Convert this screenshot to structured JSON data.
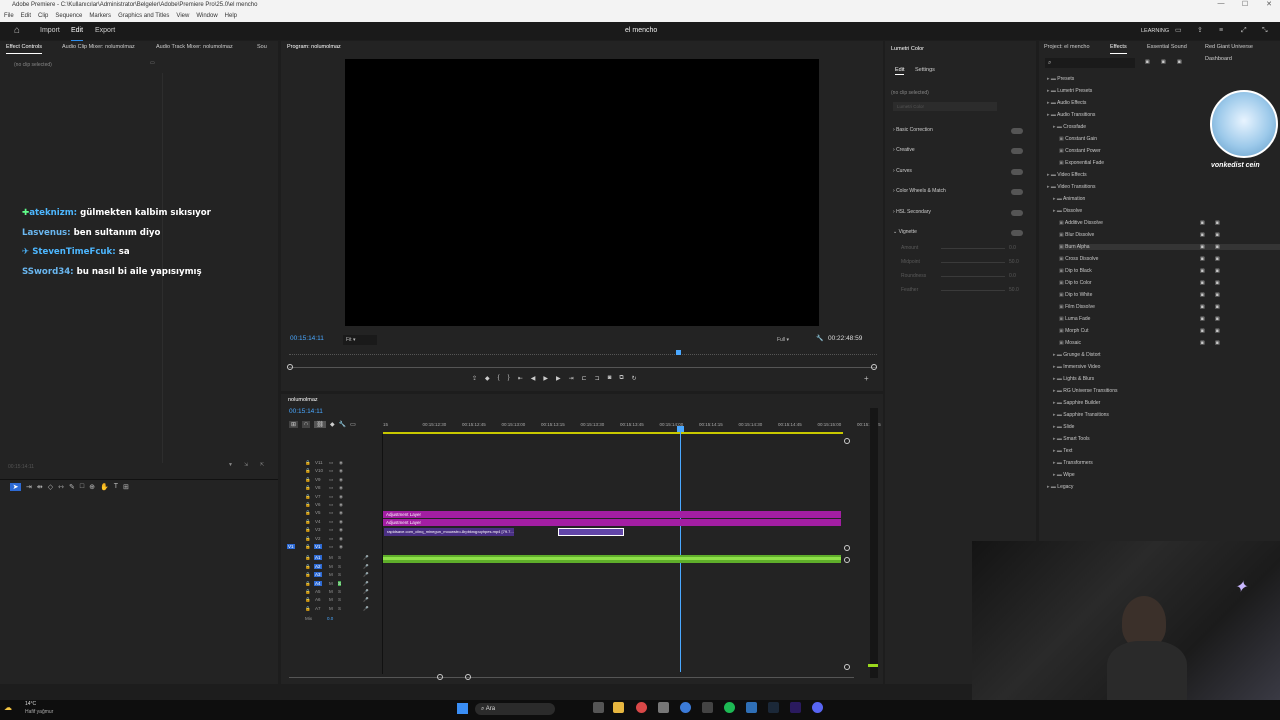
{
  "titlebar": {
    "title": "Adobe Premiere - C:\\Kullanıcılar\\Administrator\\Belgeler\\Adobe\\Premiere Pro\\25.0\\el mencho"
  },
  "menu": [
    "File",
    "Edit",
    "Clip",
    "Sequence",
    "Markers",
    "Graphics and Titles",
    "View",
    "Window",
    "Help"
  ],
  "header": {
    "tabs": [
      "Import",
      "Edit",
      "Export"
    ],
    "project_title": "el mencho",
    "learning": "LEARNING"
  },
  "left_panel": {
    "tabs": [
      "Effect Controls",
      "Audio Clip Mixer: nolumolmaz",
      "Audio Track Mixer: nolumolmaz",
      "Sou"
    ],
    "no_clip": "(no clip selected)",
    "timecode": "00:15:14:11"
  },
  "chat": [
    {
      "user": "ateknizm:",
      "text": "gülmekten kalbim sıkısıyor"
    },
    {
      "user": "Lasvenus:",
      "text": "ben sultanım diyo"
    },
    {
      "user": "StevenTimeFcuk:",
      "text": "sa"
    },
    {
      "user": "SSword34:",
      "text": "bu nasıl bi aile yapısıymış"
    }
  ],
  "program": {
    "tab": "Program: nolumolmaz",
    "timecode": "00:15:14:11",
    "fit": "Fit",
    "full": "Full",
    "duration": "00:22:48:59"
  },
  "timeline": {
    "tab": "nolumolmaz",
    "timecode": "00:15:14:11",
    "ruler": [
      "15",
      "00:15:12:30",
      "00:15:12:45",
      "00:15:13:00",
      "00:15:13:15",
      "00:15:13:30",
      "00:15:13:45",
      "00:15:14:00",
      "00:15:14:15",
      "00:15:14:30",
      "00:15:14:45",
      "00:15:15:00",
      "00:15:15:15"
    ],
    "video_tracks": [
      "V11",
      "V10",
      "V9",
      "V8",
      "V7",
      "V6",
      "V5",
      "V4",
      "V3",
      "V2",
      "V1"
    ],
    "audio_tracks": [
      "A1",
      "A2",
      "A3",
      "A4",
      "A5",
      "A6",
      "A7"
    ],
    "mix": "Mix",
    "mix_value": "0.0",
    "adj1": "Adjustment Layer",
    "adj2": "Adjustment Layer",
    "clip": "rapidsave.com_ciinq_minegun_mouwstro-8rpbknqpuyhpes.mp4 [79.7..."
  },
  "lumetri": {
    "tab": "Lumetri Color",
    "edit": "Edit",
    "settings": "Settings",
    "no_clip": "(no clip selected)",
    "dropdown": "Lumetri Color",
    "sections": [
      "Basic Correction",
      "Creative",
      "Curves",
      "Color Wheels & Match",
      "HSL Secondary",
      "Vignette"
    ],
    "vignette": [
      "Amount",
      "Midpoint",
      "Roundness",
      "Feather"
    ],
    "vignette_values": [
      "0.0",
      "50.0",
      "0.0",
      "50.0"
    ]
  },
  "effects": {
    "tabs": [
      "Project: el mencho",
      "Effects",
      "Essential Sound",
      "Red Giant Universe Dashboard"
    ],
    "tree": [
      {
        "label": "Presets",
        "level": 0
      },
      {
        "label": "Lumetri Presets",
        "level": 0
      },
      {
        "label": "Audio Effects",
        "level": 0
      },
      {
        "label": "Audio Transitions",
        "level": 0
      },
      {
        "label": "Crossfade",
        "level": 1
      },
      {
        "label": "Constant Gain",
        "level": 2
      },
      {
        "label": "Constant Power",
        "level": 2
      },
      {
        "label": "Exponential Fade",
        "level": 2
      },
      {
        "label": "Video Effects",
        "level": 0
      },
      {
        "label": "Video Transitions",
        "level": 0
      },
      {
        "label": "Animation",
        "level": 1
      },
      {
        "label": "Dissolve",
        "level": 1
      },
      {
        "label": "Additive Dissolve",
        "level": 2
      },
      {
        "label": "Blur Dissolve",
        "level": 2
      },
      {
        "label": "Burn Alpha",
        "level": 2
      },
      {
        "label": "Cross Dissolve",
        "level": 2
      },
      {
        "label": "Dip to Black",
        "level": 2
      },
      {
        "label": "Dip to Color",
        "level": 2
      },
      {
        "label": "Dip to White",
        "level": 2
      },
      {
        "label": "Film Dissolve",
        "level": 2
      },
      {
        "label": "Luma Fade",
        "level": 2
      },
      {
        "label": "Morph Cut",
        "level": 2
      },
      {
        "label": "Mosaic",
        "level": 2
      },
      {
        "label": "Grunge & Distort",
        "level": 1
      },
      {
        "label": "Immersive Video",
        "level": 1
      },
      {
        "label": "Lights & Blurs",
        "level": 1
      },
      {
        "label": "RG Universe Transitions",
        "level": 1
      },
      {
        "label": "Sapphire Builder",
        "level": 1
      },
      {
        "label": "Sapphire Transitions",
        "level": 1
      },
      {
        "label": "Slide",
        "level": 1
      },
      {
        "label": "Smart Tools",
        "level": 1
      },
      {
        "label": "Text",
        "level": 1
      },
      {
        "label": "Transformers",
        "level": 1
      },
      {
        "label": "Wipe",
        "level": 1
      },
      {
        "label": "Legacy",
        "level": 0
      }
    ]
  },
  "overlay": {
    "caption": "vonkedist cein"
  },
  "taskbar": {
    "temp": "14°C",
    "weather": "Hafif yağmur",
    "search": "Ara"
  },
  "colors": {
    "accent": "#2d8ceb",
    "adjustment": "#a31ea3",
    "audio": "#7fce3a",
    "playhead": "#4aa8ff"
  }
}
